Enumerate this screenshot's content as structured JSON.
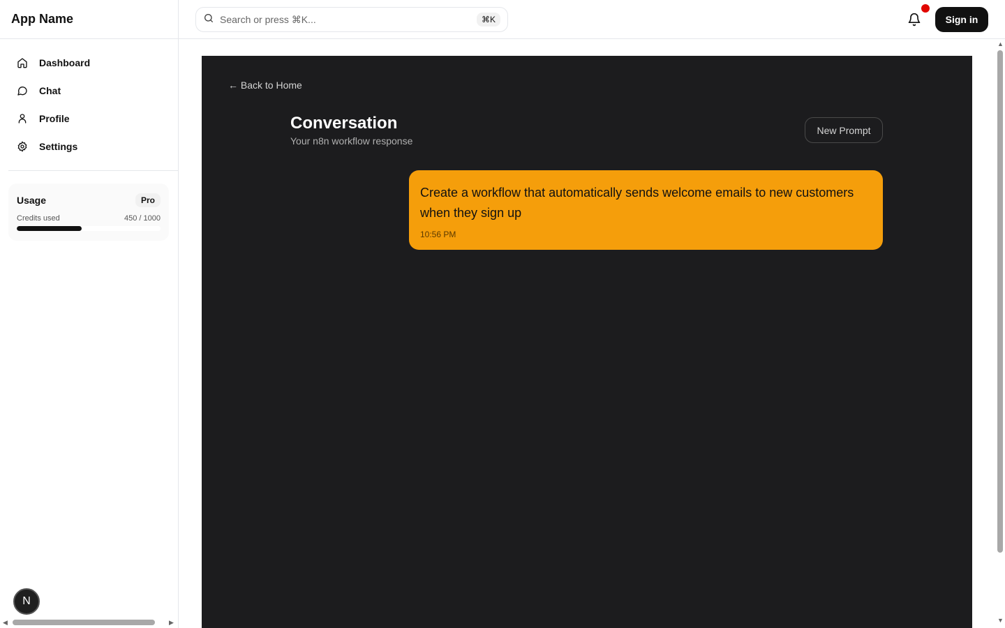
{
  "app": {
    "name": "App Name"
  },
  "sidebar": {
    "items": [
      {
        "label": "Dashboard",
        "icon": "home-icon"
      },
      {
        "label": "Chat",
        "icon": "chat-icon"
      },
      {
        "label": "Profile",
        "icon": "user-icon"
      },
      {
        "label": "Settings",
        "icon": "gear-icon"
      }
    ],
    "usage": {
      "title": "Usage",
      "plan": "Pro",
      "credits_label": "Credits used",
      "credits_value": "450 / 1000",
      "credits_fraction": 0.45
    },
    "avatar_initial": "N"
  },
  "topbar": {
    "search_placeholder": "Search or press ⌘K...",
    "shortcut": "⌘K",
    "signin_label": "Sign in"
  },
  "conversation": {
    "back_label": "← Back to Home",
    "title": "Conversation",
    "subtitle": "Your n8n workflow response",
    "new_prompt_label": "New Prompt",
    "messages": [
      {
        "text": "Create a workflow that automatically sends welcome emails to new customers when they sign up",
        "time": "10:56 PM"
      }
    ]
  },
  "colors": {
    "panel_bg": "#1c1c1e",
    "bubble": "#f59e0b",
    "accent_dark": "#111111",
    "notification_dot": "#e10600"
  }
}
